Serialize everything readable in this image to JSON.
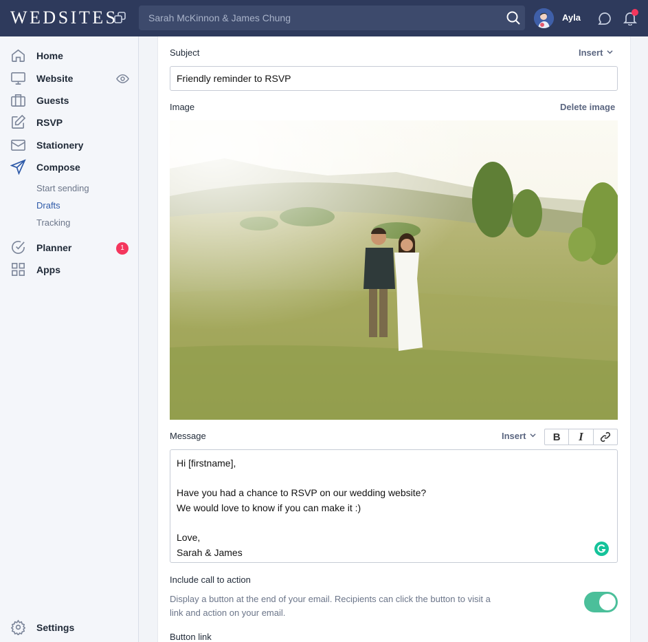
{
  "app": {
    "logo": "WEDSITES"
  },
  "search": {
    "placeholder": "Sarah McKinnon & James Chung"
  },
  "user": {
    "name": "Ayla"
  },
  "colors": {
    "topbar": "#2e3a5c",
    "accent": "#2e5aa8",
    "badge": "#f4365d",
    "toggle_on": "#4bbf9a"
  },
  "sidebar": {
    "items": [
      {
        "label": "Home",
        "icon": "home-icon"
      },
      {
        "label": "Website",
        "icon": "monitor-icon"
      },
      {
        "label": "Guests",
        "icon": "guests-icon"
      },
      {
        "label": "RSVP",
        "icon": "edit-icon"
      },
      {
        "label": "Stationery",
        "icon": "envelope-icon"
      },
      {
        "label": "Compose",
        "icon": "send-icon"
      },
      {
        "label": "Planner",
        "icon": "check-circle-icon",
        "badge": "1"
      },
      {
        "label": "Apps",
        "icon": "grid-icon"
      }
    ],
    "compose_sub": [
      {
        "label": "Start sending"
      },
      {
        "label": "Drafts",
        "active": true
      },
      {
        "label": "Tracking"
      }
    ],
    "settings_label": "Settings"
  },
  "form": {
    "subject_label": "Subject",
    "insert_label": "Insert",
    "subject_value": "Friendly reminder to RSVP",
    "image_label": "Image",
    "delete_image_label": "Delete image",
    "message_label": "Message",
    "message_lines": [
      "Hi [firstname],",
      "",
      "Have you had a chance to RSVP on our wedding website?",
      "We would love to know if you can make it :)",
      "",
      "Love,",
      "Sarah & James"
    ],
    "toolbar": {
      "bold": "B",
      "italic": "I"
    },
    "cta_label": "Include call to action",
    "cta_description": "Display a button at the end of your email. Recipients can click the button to visit a link and action on your email.",
    "cta_enabled": true,
    "button_link_label": "Button link"
  }
}
